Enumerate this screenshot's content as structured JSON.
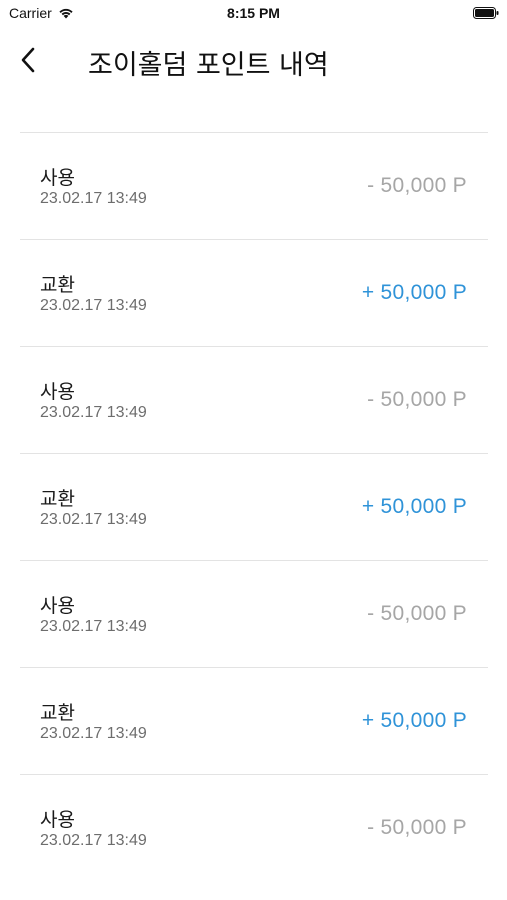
{
  "status_bar": {
    "carrier": "Carrier",
    "time": "8:15 PM"
  },
  "header": {
    "title": "조이홀덤 포인트 내역",
    "back_icon": "chevron-left-icon"
  },
  "colors": {
    "plus": "#2f93d8",
    "minus": "#a6a6a6",
    "divider": "#e3e3e3"
  },
  "transactions": [
    {
      "type": "사용",
      "date": "23.02.17 13:49",
      "amount": "- 50,000 P",
      "kind": "minus"
    },
    {
      "type": "교환",
      "date": "23.02.17 13:49",
      "amount": "+ 50,000 P",
      "kind": "plus"
    },
    {
      "type": "사용",
      "date": "23.02.17 13:49",
      "amount": "- 50,000 P",
      "kind": "minus"
    },
    {
      "type": "교환",
      "date": "23.02.17 13:49",
      "amount": "+ 50,000 P",
      "kind": "plus"
    },
    {
      "type": "사용",
      "date": "23.02.17 13:49",
      "amount": "- 50,000 P",
      "kind": "minus"
    },
    {
      "type": "교환",
      "date": "23.02.17 13:49",
      "amount": "+ 50,000 P",
      "kind": "plus"
    },
    {
      "type": "사용",
      "date": "23.02.17 13:49",
      "amount": "- 50,000 P",
      "kind": "minus"
    }
  ]
}
